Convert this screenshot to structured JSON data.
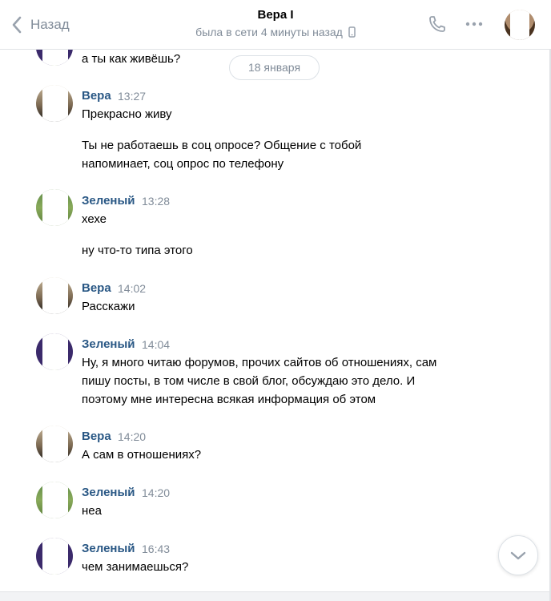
{
  "header": {
    "back_label": "Назад",
    "title": "Вера I",
    "status": "была в сети 4 минуты назад"
  },
  "date_separator": "18 января",
  "messages": [
    {
      "author": "",
      "time": "",
      "lines": [
        "а ты как живёшь?"
      ]
    },
    {
      "author": "Вера",
      "time": "13:27",
      "lines": [
        "Прекрасно живу"
      ]
    },
    {
      "author": "",
      "time": "",
      "lines": [
        "Ты не работаешь в соц опросе? Общение с тобой",
        "напоминает, соц опрос по телефону"
      ]
    },
    {
      "author": "Зеленый",
      "time": "13:28",
      "lines": [
        "хехе"
      ]
    },
    {
      "author": "",
      "time": "",
      "lines": [
        "ну что-то типа этого"
      ]
    },
    {
      "author": "Вера",
      "time": "14:02",
      "lines": [
        "Расскажи"
      ]
    },
    {
      "author": "Зеленый",
      "time": "14:04",
      "lines": [
        "Ну, я много читаю форумов, прочих сайтов об отношениях, сам",
        "пишу посты, в том числе в свой блог, обсуждаю это дело. И",
        "поэтому мне интересна всякая информация об этом"
      ]
    },
    {
      "author": "Вера",
      "time": "14:20",
      "lines": [
        "А сам в отношениях?"
      ]
    },
    {
      "author": "Зеленый",
      "time": "14:20",
      "lines": [
        "неа"
      ]
    },
    {
      "author": "Зеленый",
      "time": "16:43",
      "lines": [
        "чем занимаешься?"
      ]
    }
  ],
  "icons": {
    "back": "chevron-left-icon",
    "mobile": "phone-device-icon",
    "call": "phone-icon",
    "more": "more-icon",
    "scroll_down": "chevron-down-icon"
  },
  "colors": {
    "accent": "#2a5885",
    "secondary_text": "#818c99",
    "icon": "#99a2ad"
  }
}
